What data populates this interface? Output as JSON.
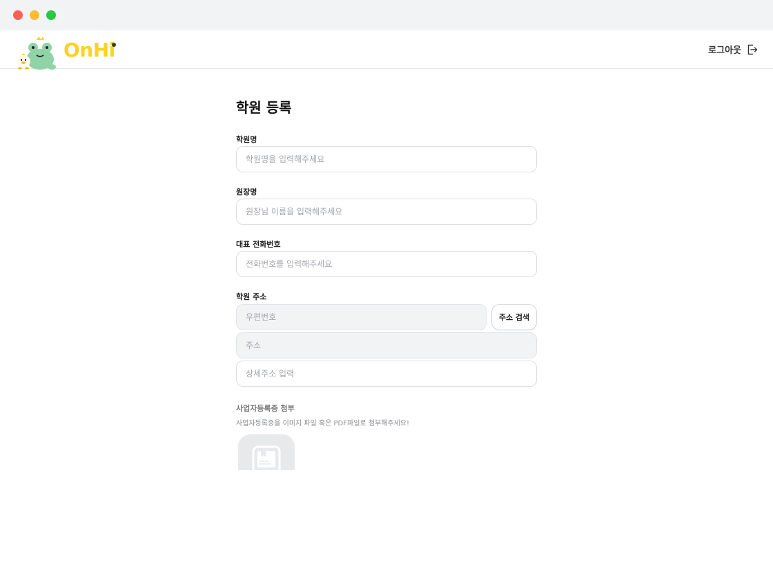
{
  "window": {
    "controls": [
      "close",
      "minimize",
      "zoom"
    ]
  },
  "header": {
    "brand": "OnHi",
    "logout_label": "로그아웃",
    "icons": {
      "logo": "frog-mascot-logo",
      "logout": "logout-icon"
    }
  },
  "form": {
    "title": "학원 등록",
    "academy_name": {
      "label": "학원명",
      "placeholder": "학원명을 입력해주세요",
      "value": ""
    },
    "director_name": {
      "label": "원장명",
      "placeholder": "원장님 이름을 입력해주세요",
      "value": ""
    },
    "phone": {
      "label": "대표 전화번호",
      "placeholder": "전화번호를 입력해주세요",
      "value": ""
    },
    "address": {
      "label": "학원 주소",
      "postal_placeholder": "우편번호",
      "search_button": "주소 검색",
      "address_placeholder": "주소",
      "detail_placeholder": "상세주소 입력"
    },
    "attachment": {
      "label": "사업자등록증 첨부",
      "description": "사업자등록증을 이미지 파일 혹은 PDF파일로 첨부해주세요!",
      "icon": "document-upload-icon"
    }
  },
  "colors": {
    "brand": "#ffd21f",
    "mascot": "#8fd3a6",
    "border": "#dcdee1",
    "disabled_bg": "#f2f3f4"
  }
}
